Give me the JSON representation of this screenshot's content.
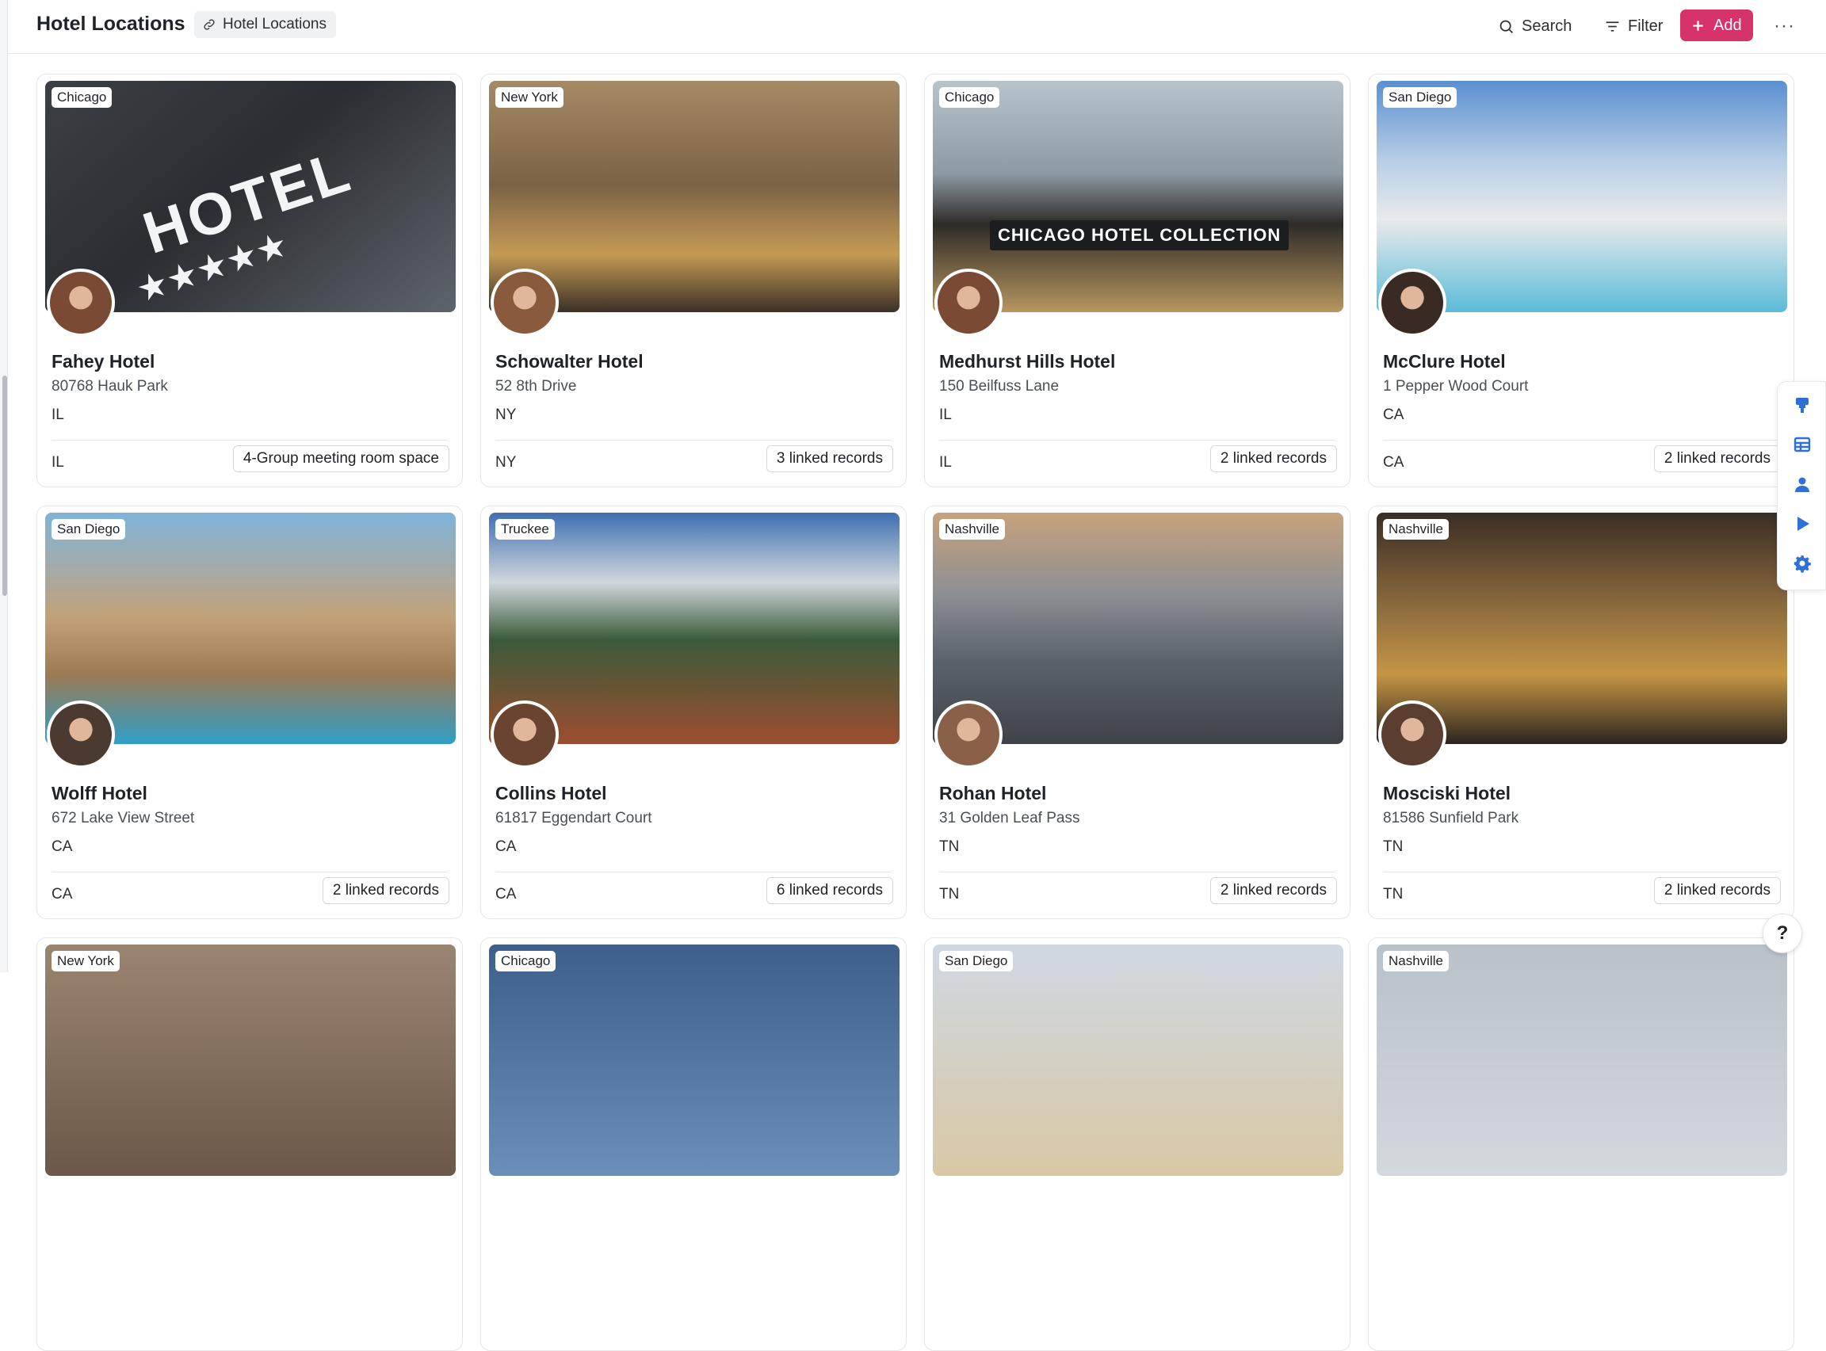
{
  "header": {
    "title": "Hotel Locations",
    "breadcrumb": "Hotel Locations",
    "search_label": "Search",
    "filter_label": "Filter",
    "add_label": "Add",
    "more_label": "···"
  },
  "cards": [
    {
      "city": "Chicago",
      "name": "Fahey Hotel",
      "address": "80768 Hauk Park",
      "state": "IL",
      "state_footer": "IL",
      "linked": "4-Group meeting room space"
    },
    {
      "city": "New York",
      "name": "Schowalter Hotel",
      "address": "52 8th Drive",
      "state": "NY",
      "state_footer": "NY",
      "linked": "3 linked records"
    },
    {
      "city": "Chicago",
      "name": "Medhurst Hills Hotel",
      "address": "150 Beilfuss Lane",
      "state": "IL",
      "state_footer": "IL",
      "linked": "2 linked records"
    },
    {
      "city": "San Diego",
      "name": "McClure Hotel",
      "address": "1 Pepper Wood Court",
      "state": "CA",
      "state_footer": "CA",
      "linked": "2 linked records"
    },
    {
      "city": "San Diego",
      "name": "Wolff Hotel",
      "address": "672 Lake View Street",
      "state": "CA",
      "state_footer": "CA",
      "linked": "2 linked records"
    },
    {
      "city": "Truckee",
      "name": "Collins Hotel",
      "address": "61817 Eggendart Court",
      "state": "CA",
      "state_footer": "CA",
      "linked": "6 linked records"
    },
    {
      "city": "Nashville",
      "name": "Rohan Hotel",
      "address": "31 Golden Leaf Pass",
      "state": "TN",
      "state_footer": "TN",
      "linked": "2 linked records"
    },
    {
      "city": "Nashville",
      "name": "Mosciski Hotel",
      "address": "81586 Sunfield Park",
      "state": "TN",
      "state_footer": "TN",
      "linked": "2 linked records"
    },
    {
      "city": "New York"
    },
    {
      "city": "Chicago"
    },
    {
      "city": "San Diego"
    },
    {
      "city": "Nashville"
    }
  ],
  "image_signs": {
    "hotel_sign": "HOTEL",
    "chicago_sign": "CHICAGO HOTEL COLLECTION"
  },
  "side_dock": [
    "plugin-icon",
    "table-icon",
    "user-icon",
    "play-icon",
    "settings-icon"
  ],
  "help_label": "?",
  "colors": {
    "accent": "#d6336c",
    "dock": "#2f6fd6"
  }
}
